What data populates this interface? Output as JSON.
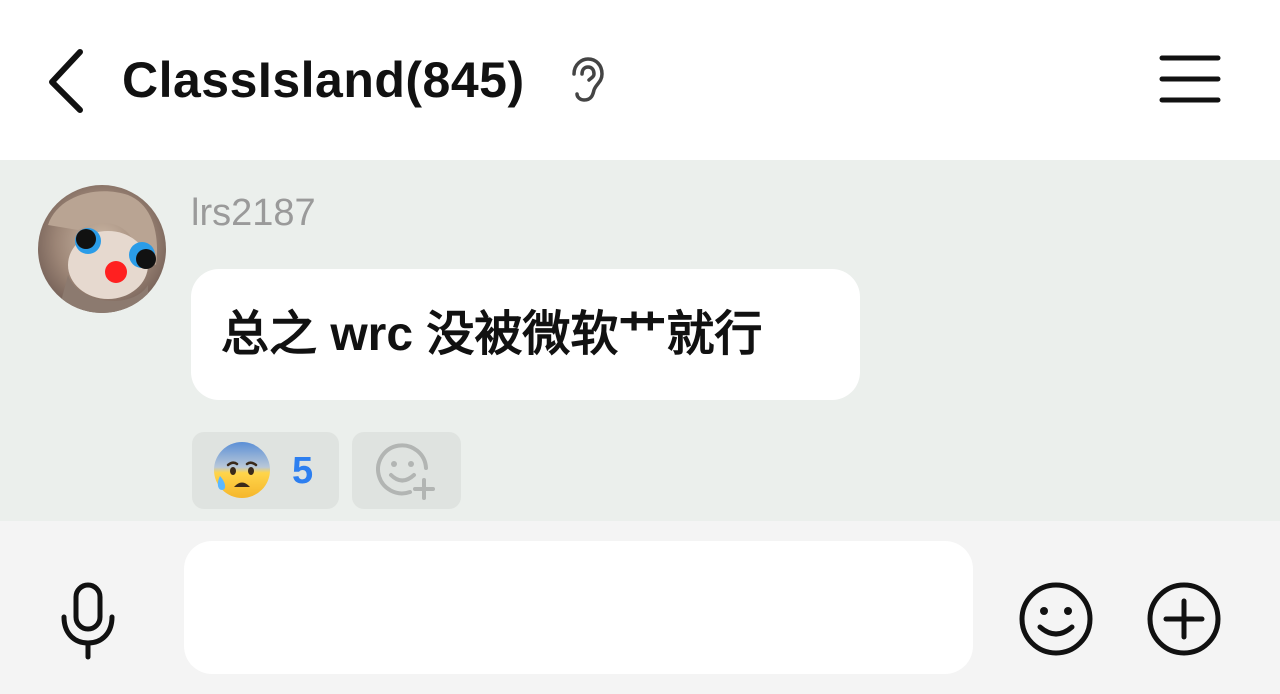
{
  "header": {
    "title": "ClassIsland(845)",
    "back_icon": "chevron-left-icon",
    "ear_icon": "ear-icon",
    "menu_icon": "hamburger-menu-icon"
  },
  "message": {
    "sender": "lrs2187",
    "text": "总之 wrc 没被微软艹就行",
    "reaction": {
      "emoji": "😰",
      "count": "5"
    },
    "add_reaction_icon": "add-reaction-icon"
  },
  "composer": {
    "input_value": "",
    "placeholder": "",
    "mic_icon": "microphone-icon",
    "emoji_icon": "smiley-icon",
    "plus_icon": "plus-circle-icon"
  },
  "colors": {
    "chat_background": "#ebefec",
    "reaction_count": "#2d7ff0",
    "sender_name": "#9a9a9a"
  }
}
